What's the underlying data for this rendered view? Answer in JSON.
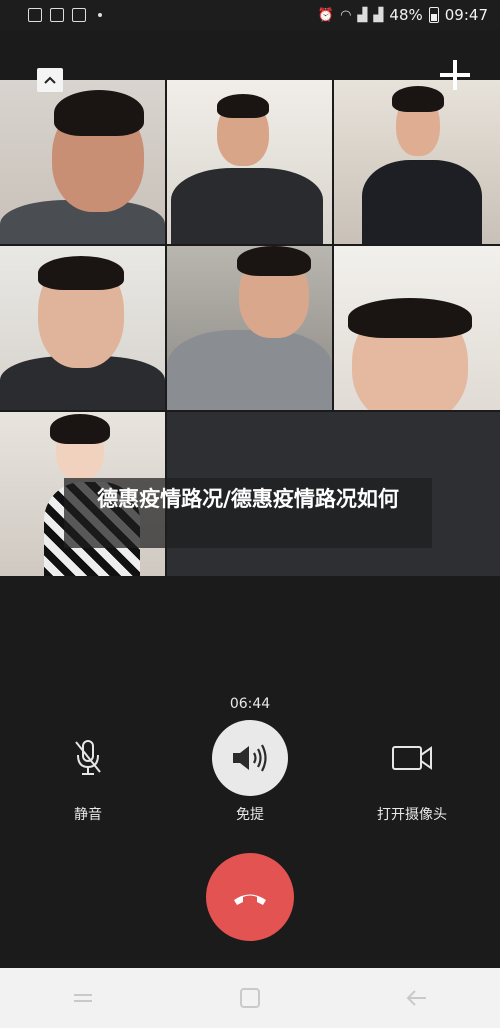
{
  "status_bar": {
    "battery_percent": "48%",
    "time": "09:47",
    "left_icons": [
      "gallery-icon",
      "paw-icon",
      "paw-icon",
      "dot-icon"
    ],
    "right_icons": [
      "alarm-icon",
      "wifi-icon",
      "signal-4g-icon",
      "signal-icon",
      "battery-icon"
    ]
  },
  "call": {
    "overlay_title": "德惠疫情路况/德惠疫情路况如何",
    "duration": "06:44",
    "mute_label": "静音",
    "speaker_label": "免提",
    "camera_label": "打开摄像头"
  },
  "colors": {
    "background": "#1b1b1b",
    "hangup": "#e25352",
    "speaker_circle": "#e9e9e9",
    "nav_bar": "#f2f2f2"
  }
}
